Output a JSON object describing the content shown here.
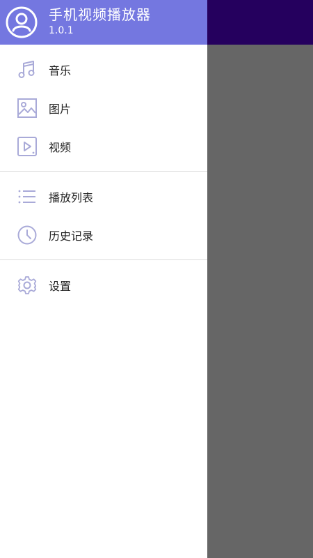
{
  "header": {
    "title": "手机视频播放器",
    "version": "1.0.1",
    "header_color": "#7477e0",
    "status_bar_color": "#25005e"
  },
  "menu_groups": [
    {
      "items": [
        {
          "label": "音乐",
          "icon": "music-note-icon"
        },
        {
          "label": "图片",
          "icon": "image-icon"
        },
        {
          "label": "视频",
          "icon": "video-play-icon"
        }
      ]
    },
    {
      "items": [
        {
          "label": "播放列表",
          "icon": "list-icon"
        },
        {
          "label": "历史记录",
          "icon": "clock-icon"
        }
      ]
    },
    {
      "items": [
        {
          "label": "设置",
          "icon": "gear-icon"
        }
      ]
    }
  ],
  "colors": {
    "icon": "#a9aad8",
    "scrim": "#666666"
  }
}
